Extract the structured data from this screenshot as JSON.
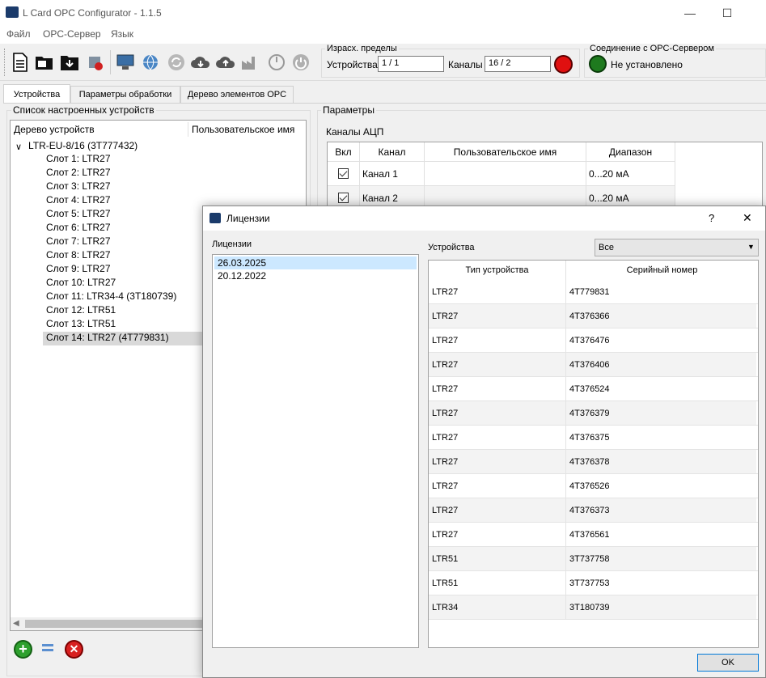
{
  "window": {
    "title": "L Card OPC Configurator - 1.1.5",
    "minimize": "—",
    "maximize": "☐"
  },
  "menu": [
    "Файл",
    "OPC-Сервер",
    "Язык"
  ],
  "limits": {
    "title": "Израсх. пределы",
    "devices_label": "Устройства",
    "devices_value": "1 / 1",
    "channels_label": "Каналы",
    "channels_value": "16 / 2"
  },
  "connection": {
    "title": "Соединение с OPC-Сервером",
    "status": "Не установлено"
  },
  "tabs": [
    "Устройства",
    "Параметры обработки",
    "Дерево элементов OPC"
  ],
  "left_panel": {
    "title": "Список настроенных устройств",
    "col_tree": "Дерево устройств",
    "col_user_name": "Пользовательское имя",
    "root": "LTR-EU-8/16 (3T777432)",
    "slots": [
      "Слот  1: LTR27",
      "Слот  2: LTR27",
      "Слот  3: LTR27",
      "Слот  4: LTR27",
      "Слот  5: LTR27",
      "Слот  6: LTR27",
      "Слот  7: LTR27",
      "Слот  8: LTR27",
      "Слот  9: LTR27",
      "Слот 10: LTR27",
      "Слот 11: LTR34-4 (3T180739)",
      "Слот 12: LTR51",
      "Слот 13: LTR51",
      "Слот 14: LTR27 (4T779831)"
    ]
  },
  "right_panel": {
    "title": "Параметры",
    "section": "Каналы АЦП",
    "headers": [
      "Вкл",
      "Канал",
      "Пользовательское имя",
      "Диапазон"
    ],
    "rows": [
      {
        "channel": "Канал 1",
        "range": "0...20 мА"
      },
      {
        "channel": "Канал 2",
        "range": "0...20 мА"
      }
    ]
  },
  "dialog": {
    "title": "Лицензии",
    "help": "?",
    "close": "✕",
    "licenses_label": "Лицензии",
    "licenses": [
      "26.03.2025",
      "20.12.2022"
    ],
    "devices_label": "Устройства",
    "filter_value": "Все",
    "col_type": "Тип устройства",
    "col_serial": "Серийный номер",
    "devices": [
      {
        "type": "LTR27",
        "serial": "4T779831"
      },
      {
        "type": "LTR27",
        "serial": "4T376366"
      },
      {
        "type": "LTR27",
        "serial": "4T376476"
      },
      {
        "type": "LTR27",
        "serial": "4T376406"
      },
      {
        "type": "LTR27",
        "serial": "4T376524"
      },
      {
        "type": "LTR27",
        "serial": "4T376379"
      },
      {
        "type": "LTR27",
        "serial": "4T376375"
      },
      {
        "type": "LTR27",
        "serial": "4T376378"
      },
      {
        "type": "LTR27",
        "serial": "4T376526"
      },
      {
        "type": "LTR27",
        "serial": "4T376373"
      },
      {
        "type": "LTR27",
        "serial": "4T376561"
      },
      {
        "type": "LTR51",
        "serial": "3T737758"
      },
      {
        "type": "LTR51",
        "serial": "3T737753"
      },
      {
        "type": "LTR34",
        "serial": "3T180739"
      }
    ],
    "ok": "OK"
  },
  "colors": {
    "accent_select": "#cce8ff",
    "status_red": "#e01010",
    "status_green": "#1e7a1e"
  }
}
